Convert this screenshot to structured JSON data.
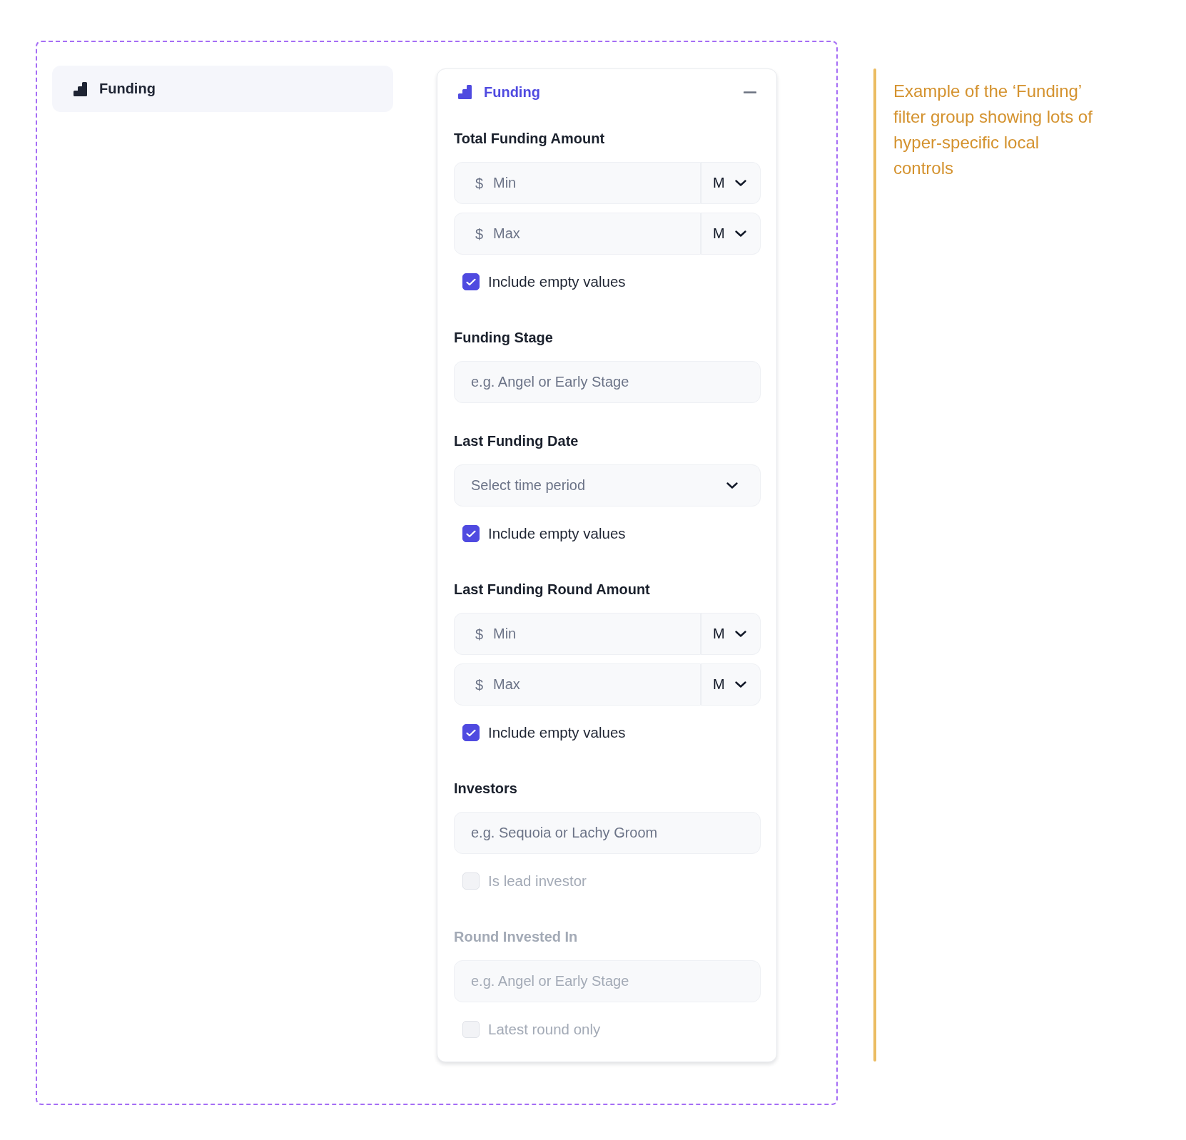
{
  "sidebar_item": {
    "label": "Funding"
  },
  "panel": {
    "title": "Funding",
    "expanded": true,
    "sections": [
      {
        "label": "Total Funding Amount",
        "disabled": false,
        "fields": [
          {
            "kind": "amount",
            "currency": "$",
            "placeholder": "Min",
            "unit": "M"
          },
          {
            "kind": "amount",
            "currency": "$",
            "placeholder": "Max",
            "unit": "M"
          }
        ],
        "checkbox": {
          "label": "Include empty values",
          "checked": true,
          "disabled": false
        }
      },
      {
        "label": "Funding Stage",
        "disabled": false,
        "fields": [
          {
            "kind": "text",
            "placeholder": "e.g. Angel or Early Stage"
          }
        ]
      },
      {
        "label": "Last Funding Date",
        "disabled": false,
        "fields": [
          {
            "kind": "select",
            "placeholder": "Select time period"
          }
        ],
        "checkbox": {
          "label": "Include empty values",
          "checked": true,
          "disabled": false
        }
      },
      {
        "label": "Last Funding Round Amount",
        "disabled": false,
        "fields": [
          {
            "kind": "amount",
            "currency": "$",
            "placeholder": "Min",
            "unit": "M"
          },
          {
            "kind": "amount",
            "currency": "$",
            "placeholder": "Max",
            "unit": "M"
          }
        ],
        "checkbox": {
          "label": "Include empty values",
          "checked": true,
          "disabled": false
        }
      },
      {
        "label": "Investors",
        "disabled": false,
        "fields": [
          {
            "kind": "text",
            "placeholder": "e.g. Sequoia or Lachy Groom"
          }
        ],
        "checkbox": {
          "label": "Is lead investor",
          "checked": false,
          "disabled": true
        }
      },
      {
        "label": "Round Invested In",
        "disabled": true,
        "fields": [
          {
            "kind": "text",
            "placeholder": "e.g. Angel or Early Stage"
          }
        ],
        "checkbox": {
          "label": "Latest round only",
          "checked": false,
          "disabled": true
        }
      }
    ]
  },
  "annotation": {
    "text": "Example of the ‘Funding’ filter group showing lots of hyper-specific local controls"
  }
}
